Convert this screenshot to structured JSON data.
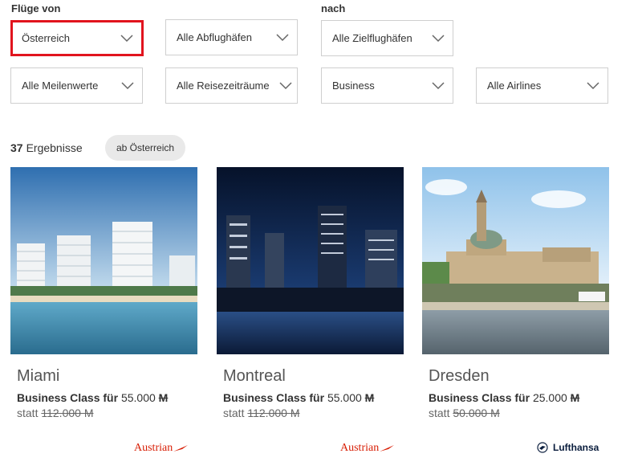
{
  "filters": {
    "from_label": "Flüge von",
    "to_label": "nach",
    "origin": "Österreich",
    "departure_airport": "Alle Abflughäfen",
    "destination_airport": "Alle Zielflughäfen",
    "miles": "Alle Meilenwerte",
    "travel_period": "Alle Reisezeiträume",
    "cabin": "Business",
    "airlines": "Alle Airlines"
  },
  "results": {
    "count": "37",
    "label": "Ergebnisse",
    "chip": "ab Österreich"
  },
  "offers": [
    {
      "city": "Miami",
      "price_prefix": "Business Class für",
      "price": "55.000",
      "miles_symbol": "M",
      "old_prefix": "statt",
      "old_price": "112.000 M",
      "airline": "Austrian"
    },
    {
      "city": "Montreal",
      "price_prefix": "Business Class für",
      "price": "55.000",
      "miles_symbol": "M",
      "old_prefix": "statt",
      "old_price": "112.000 M",
      "airline": "Austrian"
    },
    {
      "city": "Dresden",
      "price_prefix": "Business Class für",
      "price": "25.000",
      "miles_symbol": "M",
      "old_prefix": "statt",
      "old_price": "50.000 M",
      "airline": "Lufthansa"
    }
  ],
  "colors": {
    "highlight": "#e1141e",
    "austrian_red": "#d81e05",
    "lufthansa_navy": "#0a1d3d"
  },
  "icons": {
    "dropdown": "chevron-down-icon"
  }
}
